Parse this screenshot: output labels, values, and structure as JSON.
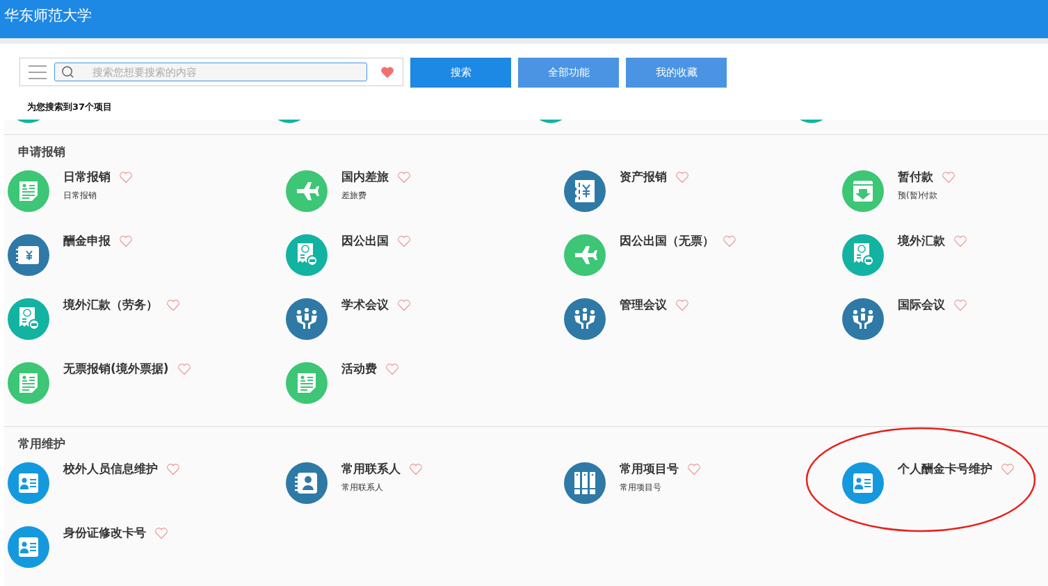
{
  "header": {
    "title": "华东师范大学"
  },
  "search": {
    "placeholder": "搜索您想要搜索的内容"
  },
  "buttons": [
    {
      "label": "搜索",
      "kind": "primary"
    },
    {
      "label": "全部功能",
      "kind": "secondary"
    },
    {
      "label": "我的收藏",
      "kind": "secondary"
    }
  ],
  "result_summary": "为您搜索到37个项目",
  "sections": [
    {
      "title": "申请报销",
      "items": [
        {
          "title": "日常报销",
          "subtitle": "日常报销",
          "kind": "form",
          "favorite": false,
          "highlighted": false
        },
        {
          "title": "国内差旅",
          "subtitle": "差旅费",
          "kind": "plane",
          "favorite": false,
          "highlighted": false
        },
        {
          "title": "资产报销",
          "kind": "receipt",
          "favorite": false,
          "highlighted": false
        },
        {
          "title": "暂付款",
          "subtitle": "预(暂)付款",
          "kind": "download",
          "favorite": false,
          "highlighted": false
        },
        {
          "title": "酬金申报",
          "kind": "wallet",
          "favorite": false,
          "highlighted": false
        },
        {
          "title": "因公出国",
          "kind": "voucher",
          "favorite": false,
          "highlighted": false
        },
        {
          "title": "因公出国（无票）",
          "kind": "plane",
          "favorite": false,
          "highlighted": false
        },
        {
          "title": "境外汇款",
          "kind": "voucher",
          "favorite": false,
          "highlighted": false
        },
        {
          "title": "境外汇款（劳务）",
          "kind": "voucher",
          "favorite": false,
          "highlighted": false
        },
        {
          "title": "学术会议",
          "kind": "meeting",
          "favorite": false,
          "highlighted": false
        },
        {
          "title": "管理会议",
          "kind": "meeting",
          "favorite": false,
          "highlighted": false
        },
        {
          "title": "国际会议",
          "kind": "meeting",
          "favorite": false,
          "highlighted": false
        },
        {
          "title": "无票报销(境外票据)",
          "kind": "form",
          "favorite": false,
          "highlighted": false
        },
        {
          "title": "活动费",
          "kind": "form",
          "favorite": false,
          "highlighted": false
        }
      ]
    },
    {
      "title": "常用维护",
      "items": [
        {
          "title": "校外人员信息维护",
          "kind": "card",
          "favorite": false,
          "highlighted": false
        },
        {
          "title": "常用联系人",
          "subtitle": "常用联系人",
          "kind": "contact",
          "favorite": false,
          "highlighted": false
        },
        {
          "title": "常用项目号",
          "subtitle": "常用项目号",
          "kind": "binder",
          "favorite": false,
          "highlighted": false
        },
        {
          "title": "个人酬金卡号维护",
          "kind": "card",
          "favorite": false,
          "highlighted": true
        },
        {
          "title": "身份证修改卡号",
          "kind": "card",
          "favorite": false,
          "highlighted": false
        }
      ]
    }
  ]
}
